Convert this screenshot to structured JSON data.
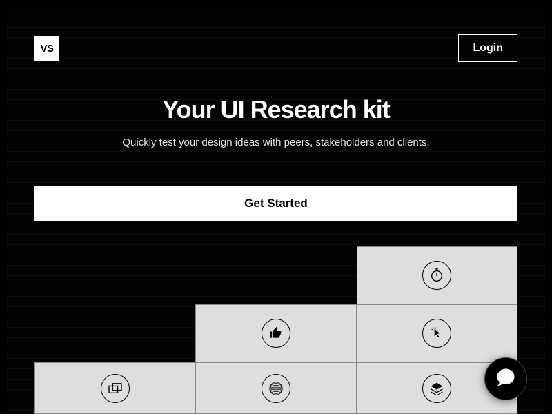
{
  "header": {
    "logo_text": "VS",
    "login_label": "Login"
  },
  "hero": {
    "title": "Your UI Research kit",
    "subtitle": "Quickly test your design ideas with peers, stakeholders and clients."
  },
  "cta": {
    "label": "Get Started"
  },
  "features": {
    "grid": [
      {
        "row": 1,
        "col": 3,
        "icon": "stopwatch-icon"
      },
      {
        "row": 2,
        "col": 2,
        "icon": "thumbs-up-icon"
      },
      {
        "row": 2,
        "col": 3,
        "icon": "click-cursor-icon"
      },
      {
        "row": 3,
        "col": 1,
        "icon": "overlap-windows-icon"
      },
      {
        "row": 3,
        "col": 2,
        "icon": "sphere-lines-icon"
      },
      {
        "row": 3,
        "col": 3,
        "icon": "layers-stack-icon"
      }
    ]
  },
  "chat": {
    "icon": "chat-bubble-icon"
  }
}
